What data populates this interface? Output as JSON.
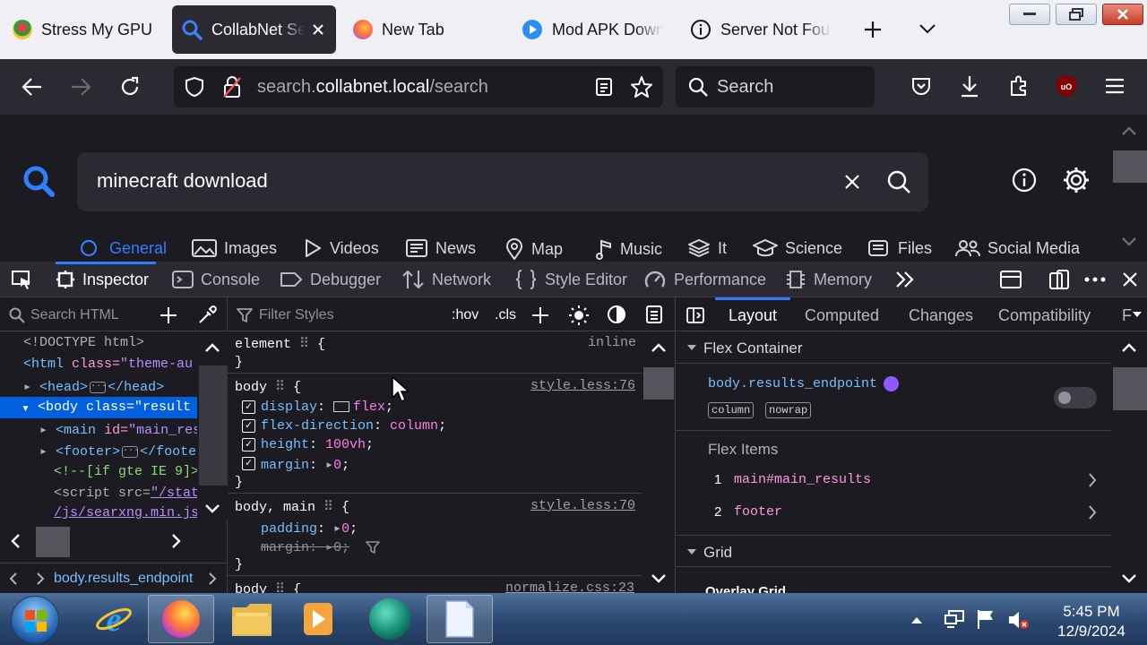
{
  "tabs": [
    {
      "label": "Stress My GPU",
      "icon": "stress-gpu-icon"
    },
    {
      "label": "CollabNet Se",
      "icon": "search-icon",
      "active": true
    },
    {
      "label": "New Tab",
      "icon": "firefox-icon"
    },
    {
      "label": "Mod APK Down",
      "icon": "mod-apk-icon"
    },
    {
      "label": "Server Not Fou",
      "icon": "info-icon"
    }
  ],
  "address": {
    "domain_pre": "search.",
    "domain_main": "collabnet.local",
    "path": "/search"
  },
  "search_box_placeholder": "Search",
  "query": "minecraft download",
  "categories": [
    "General",
    "Images",
    "Videos",
    "News",
    "Map",
    "Music",
    "It",
    "Science",
    "Files",
    "Social Media"
  ],
  "devtools": {
    "tabs": [
      "Inspector",
      "Console",
      "Debugger",
      "Network",
      "Style Editor",
      "Performance",
      "Memory"
    ],
    "search_html_placeholder": "Search HTML",
    "filter_styles_placeholder": "Filter Styles",
    "hov": ":hov",
    "cls": ".cls",
    "breadcrumb": "body.results_endpoint",
    "markup": {
      "doctype": "<!DOCTYPE html>",
      "html_tag": "<html",
      "html_attr": "class=",
      "html_val": "\"theme-au",
      "head": "<head>",
      "head_close": "</head>",
      "body_tag": "<body",
      "body_attr": "class=",
      "body_val": "\"result",
      "main_tag": "<main",
      "main_attr": "id=",
      "main_val": "\"main_res",
      "footer_tag": "<footer>",
      "footer_close": "</foote",
      "comment": "<!--[if gte IE 9]>",
      "script_tag": "<script",
      "script_attr": "src=",
      "script_val": "\"/stat",
      "script_path": "/js/searxng.min.js"
    },
    "rules": {
      "element_selector": "element",
      "element_source": "inline",
      "r1_selector": "body",
      "r1_source": "style.less:76",
      "r1_decls": [
        {
          "prop": "display",
          "value": "flex"
        },
        {
          "prop": "flex-direction",
          "value": "column"
        },
        {
          "prop": "height",
          "value": "100vh"
        },
        {
          "prop": "margin",
          "value": "0"
        }
      ],
      "r2_selector": "body, main",
      "r2_source": "style.less:70",
      "r2_decls": [
        {
          "prop": "padding",
          "value": "0"
        },
        {
          "prop": "margin",
          "value": "0"
        }
      ],
      "r3_selector": "body",
      "r3_source": "normalize.css:23"
    },
    "layout_tabs": [
      "Layout",
      "Computed",
      "Changes",
      "Compatibility",
      "F"
    ],
    "flex_container_title": "Flex Container",
    "flex_container_selector": "body.results_endpoint",
    "badges": [
      "column",
      "nowrap"
    ],
    "flex_items_title": "Flex Items",
    "flex_items": [
      {
        "n": "1",
        "name": "main#main_results"
      },
      {
        "n": "2",
        "name": "footer"
      }
    ],
    "grid_title": "Grid",
    "overlay_grid": "Overlay Grid"
  },
  "taskbar": {
    "time": "5:45 PM",
    "date": "12/9/2024"
  },
  "colors": {
    "accent": "#2f7fff",
    "devtools_bg": "#1c1b22",
    "toolbar_bg": "#2b2a33",
    "tab_strip": "#f0f0f4",
    "purple_dot": "#9059ff"
  }
}
